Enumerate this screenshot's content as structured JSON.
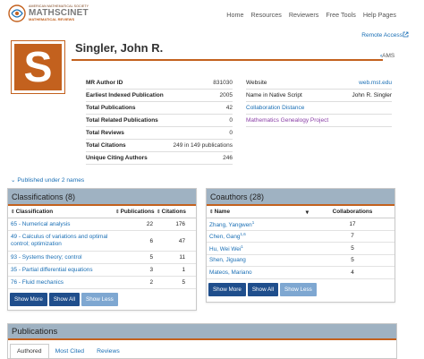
{
  "header": {
    "logo": {
      "line1": "AMERICAN MATHEMATICAL SOCIETY",
      "line2": "MATHSCINET",
      "line3": "MATHEMATICAL REVIEWS"
    },
    "nav": [
      "Home",
      "Resources",
      "Reviewers",
      "Free Tools",
      "Help Pages"
    ],
    "remote_access": "Remote Access"
  },
  "author": {
    "initial": "S",
    "name": "Singler, John R.",
    "ams_tag": "AMS"
  },
  "stats": [
    {
      "label": "MR Author ID",
      "value": "831030"
    },
    {
      "label": "Earliest Indexed Publication",
      "value": "2005"
    },
    {
      "label": "Total Publications",
      "value": "42"
    },
    {
      "label": "Total Related Publications",
      "value": "0"
    },
    {
      "label": "Total Reviews",
      "value": "0"
    },
    {
      "label": "Total Citations",
      "value": "249 in 149 publications"
    },
    {
      "label": "Unique Citing Authors",
      "value": "246"
    }
  ],
  "info": {
    "website_label": "Website",
    "website_value": "web.mst.edu",
    "native_label": "Name in Native Script",
    "native_value": "John R. Singler",
    "collab_distance": "Collaboration Distance",
    "genealogy": "Mathematics Genealogy Project"
  },
  "published_names": "Published under 2 names",
  "classifications": {
    "title": "Classifications (8)",
    "columns": [
      "Classification",
      "Publications",
      "Citations"
    ],
    "rows": [
      {
        "name": "65 - Numerical analysis",
        "pubs": "22",
        "cites": "176"
      },
      {
        "name": "49 - Calculus of variations and optimal control; optimization",
        "pubs": "6",
        "cites": "47"
      },
      {
        "name": "93 - Systems theory; control",
        "pubs": "5",
        "cites": "11"
      },
      {
        "name": "35 - Partial differential equations",
        "pubs": "3",
        "cites": "1"
      },
      {
        "name": "76 - Fluid mechanics",
        "pubs": "2",
        "cites": "5"
      }
    ],
    "buttons": {
      "more": "Show More",
      "all": "Show All",
      "less": "Show Less"
    }
  },
  "coauthors": {
    "title": "Coauthors (28)",
    "columns": [
      "Name",
      "Collaborations"
    ],
    "rows": [
      {
        "name": "Zhang, Yangwen",
        "sup": "1",
        "count": "17"
      },
      {
        "name": "Chen, Gang",
        "sup": "1,6",
        "count": "7"
      },
      {
        "name": "Hu, Wei Wei",
        "sup": "1",
        "count": "5"
      },
      {
        "name": "Shen, Jiguang",
        "sup": "",
        "count": "5"
      },
      {
        "name": "Mateos, Mariano",
        "sup": "",
        "count": "4"
      }
    ],
    "buttons": {
      "more": "Show More",
      "all": "Show All",
      "less": "Show Less"
    }
  },
  "publications": {
    "title": "Publications",
    "tabs": [
      "Authored",
      "Most Cited",
      "Reviews"
    ]
  },
  "colors": {
    "accent": "#c3611e",
    "link": "#1a6fb5",
    "panel_header": "#9fb2c2",
    "button": "#1f4e8c",
    "button_disabled": "#7ea7d1"
  }
}
